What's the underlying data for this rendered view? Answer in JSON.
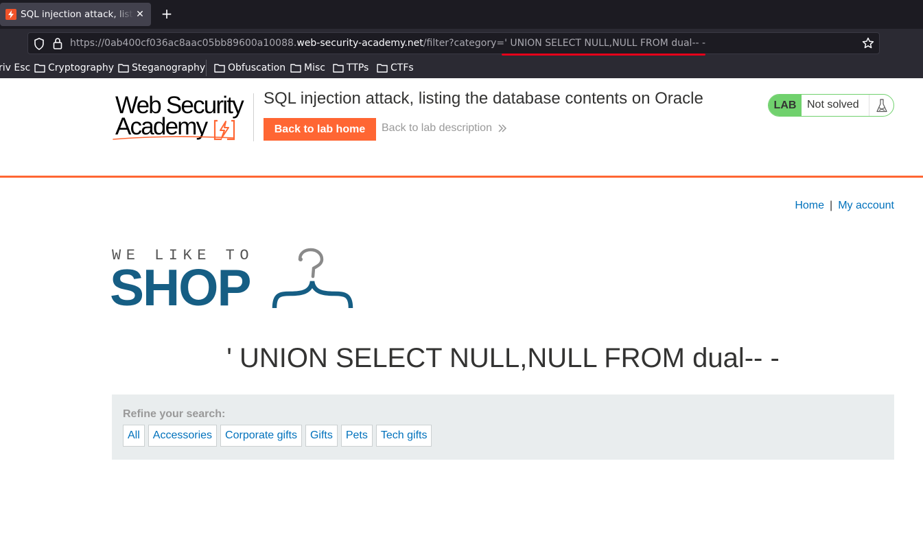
{
  "browser": {
    "tab_title": "SQL injection attack, listing the database contents on Oracle",
    "new_tab_label": "+",
    "url_prefix": "https://0ab400cf036ac8aac05bb89600a10088.",
    "url_host": "web-security-academy.net",
    "url_path": "/filter?category=' UNION SELECT NULL,NULL FROM dual-- -",
    "bookmarks": [
      "riv Esc",
      "Cryptography",
      "Steganography",
      "Obfuscation",
      "Misc",
      "TTPs",
      "CTFs"
    ]
  },
  "lab_header": {
    "logo_line1": "Web Security",
    "logo_line2": "Academy",
    "title": "SQL injection attack, listing the database contents on Oracle",
    "back_home_label": "Back to lab home",
    "back_description_label": "Back to lab description",
    "status_badge": "LAB",
    "status_text": "Not solved",
    "accent_color": "#ff6633",
    "status_color": "#70d16d"
  },
  "nav": {
    "home_label": "Home",
    "separator": "|",
    "account_label": "My account"
  },
  "shop_logo": {
    "tagline": "WE LIKE TO",
    "word": "SHOP"
  },
  "main": {
    "search_heading": "' UNION SELECT NULL,NULL FROM dual-- -",
    "refine_label": "Refine your search:",
    "filters": [
      "All",
      "Accessories",
      "Corporate gifts",
      "Gifts",
      "Pets",
      "Tech gifts"
    ]
  }
}
